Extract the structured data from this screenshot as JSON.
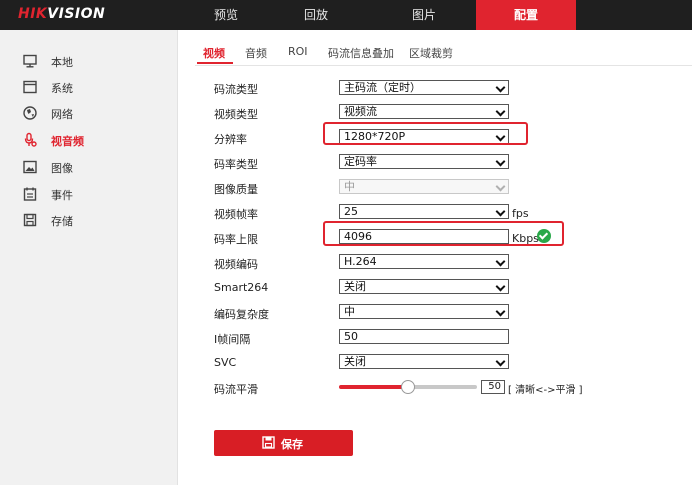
{
  "brand": {
    "logo_red": "HIK",
    "logo_white": "VISION"
  },
  "nav": {
    "items": [
      {
        "label": "预览"
      },
      {
        "label": "回放"
      },
      {
        "label": "图片"
      },
      {
        "label": "配置"
      }
    ],
    "active": "配置"
  },
  "sidebar": {
    "items": [
      {
        "label": "本地",
        "icon": "monitor-icon"
      },
      {
        "label": "系统",
        "icon": "system-window-icon"
      },
      {
        "label": "网络",
        "icon": "globe-icon"
      },
      {
        "label": "视音频",
        "icon": "microphone-icon"
      },
      {
        "label": "图像",
        "icon": "image-icon"
      },
      {
        "label": "事件",
        "icon": "calendar-icon"
      },
      {
        "label": "存储",
        "icon": "floppy-disk-icon"
      }
    ],
    "active": "视音频"
  },
  "tabs": {
    "items": [
      {
        "label": "视频"
      },
      {
        "label": "音频"
      },
      {
        "label": "ROI"
      },
      {
        "label": "码流信息叠加"
      },
      {
        "label": "区域裁剪"
      }
    ],
    "active": "视频"
  },
  "form": {
    "stream_type": {
      "label": "码流类型",
      "value": "主码流（定时）"
    },
    "video_type": {
      "label": "视频类型",
      "value": "视频流"
    },
    "resolution": {
      "label": "分辨率",
      "value": "1280*720P"
    },
    "bitrate_type": {
      "label": "码率类型",
      "value": "定码率"
    },
    "image_quality": {
      "label": "图像质量",
      "value": "中"
    },
    "frame_rate": {
      "label": "视频帧率",
      "value": "25",
      "unit": "fps"
    },
    "max_bitrate": {
      "label": "码率上限",
      "value": "4096",
      "unit": "Kbps"
    },
    "video_encoding": {
      "label": "视频编码",
      "value": "H.264"
    },
    "smart264": {
      "label": "Smart264",
      "value": "关闭"
    },
    "encoding_complexity": {
      "label": "编码复杂度",
      "value": "中"
    },
    "i_frame_interval": {
      "label": "I帧间隔",
      "value": "50"
    },
    "svc": {
      "label": "SVC",
      "value": "关闭"
    },
    "stream_smoothing": {
      "label": "码流平滑",
      "value": "50",
      "range_text": "[ 清晰<->平滑 ]",
      "level": 0.5
    }
  },
  "save": {
    "label": "保存"
  },
  "colors": {
    "accent": "#e0242f",
    "topbar": "#1f1f1f",
    "ok": "#2aa84a"
  }
}
